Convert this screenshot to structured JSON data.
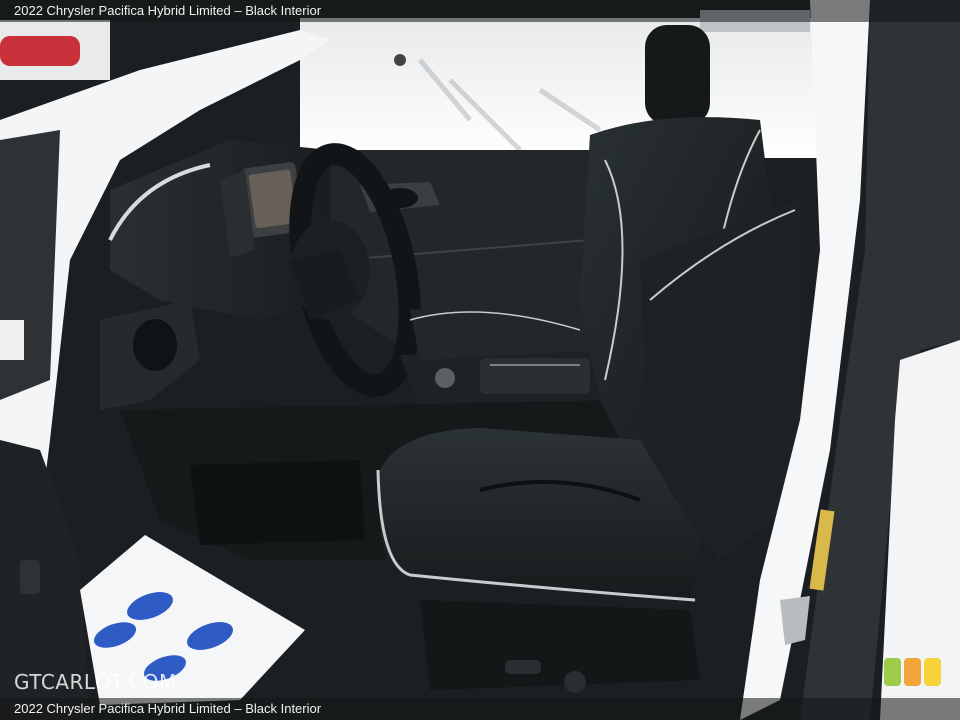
{
  "caption": {
    "top": "2022 Chrysler Pacifica Hybrid Limited – Black Interior",
    "bottom": "2022 Chrysler Pacifica Hybrid Limited – Black Interior"
  },
  "watermark": {
    "text": "GTCARLOT.COM"
  },
  "rating_lights": {
    "colors": [
      "#9ccc4a",
      "#f2a33a",
      "#f7d23a"
    ]
  },
  "photo": {
    "subject_colors": {
      "snow": "#f2f4f6",
      "interior": "#1c2022",
      "seat_piping": "#c9ccce",
      "body_paint": "#f6f7f8"
    }
  }
}
